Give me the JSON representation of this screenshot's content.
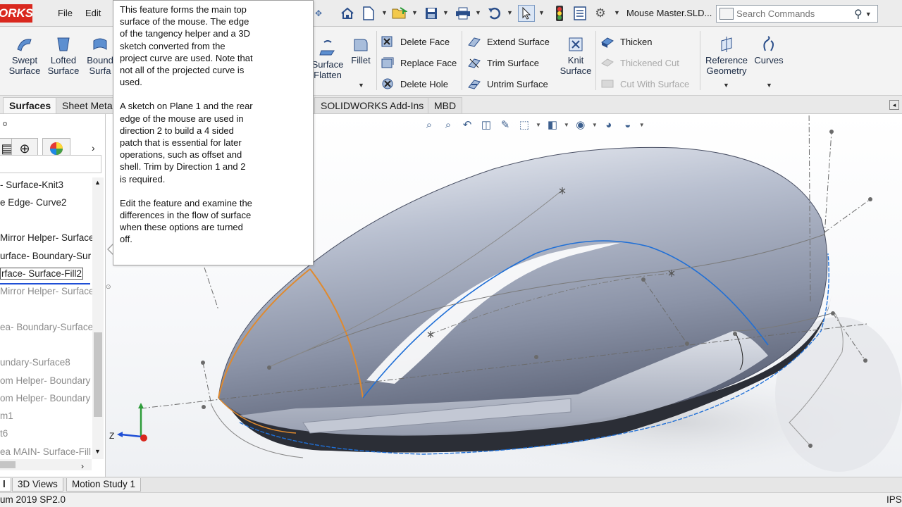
{
  "app": {
    "logo_text": "ORKS",
    "menu": [
      "File",
      "Edit"
    ],
    "document_title": "Mouse Master.SLD...",
    "search": {
      "placeholder": "Search Commands"
    }
  },
  "quick_access_icons": [
    "home-icon",
    "new-document-icon",
    "open-icon",
    "save-icon",
    "print-icon",
    "undo-icon",
    "select-cursor-icon",
    "traffic-light-icon",
    "file-properties-icon",
    "options-gear-icon"
  ],
  "ribbon": {
    "left_buttons": [
      {
        "id": "swept",
        "label": "Swept\nSurface"
      },
      {
        "id": "lofted",
        "label": "Lofted\nSurface"
      },
      {
        "id": "boundary",
        "label": "Bound\nSurfa"
      }
    ],
    "surface_flatten": "Surface\nFlatten",
    "fillet": "Fillet",
    "face_group": [
      "Delete Face",
      "Replace Face",
      "Delete Hole"
    ],
    "surface_group": [
      "Extend Surface",
      "Trim Surface",
      "Untrim Surface"
    ],
    "knit": "Knit\nSurface",
    "thicken_group": [
      {
        "label": "Thicken",
        "enabled": true
      },
      {
        "label": "Thickened Cut",
        "enabled": false
      },
      {
        "label": "Cut With Surface",
        "enabled": false
      }
    ],
    "reference_geometry": "Reference\nGeometry",
    "curves": "Curves"
  },
  "command_tabs": [
    "Surfaces",
    "Sheet Metal",
    "SOLIDWORKS Add-Ins",
    "MBD"
  ],
  "active_command_tab": "Surfaces",
  "tooltip": {
    "paragraphs": [
      "This feature forms the main top\n surface of the mouse. The edge\n of the tangency helper and a 3D\n sketch converted from the\n project curve are used. Note that\n not all of the projected curve is\n used.",
      "A sketch on Plane 1 and the rear\n edge of the mouse are used in\n direction 2 to build a 4 sided\n patch that is essential for later\n operations, such as offset and\n shell. Trim by Direction 1 and 2\n is required.",
      "Edit the feature and examine the\n differences in the flow of surface\n when these options are turned\n off."
    ]
  },
  "feature_tree": {
    "items": [
      {
        "text": "- Surface-Knit3",
        "dim": false
      },
      {
        "text": "e Edge- Curve2",
        "dim": false
      },
      {
        "text": "Mirror Helper- Surface",
        "dim": false
      },
      {
        "text": "urface- Boundary-Sur",
        "dim": false
      },
      {
        "text": "rface- Surface-Fill2",
        "dim": false,
        "selected": true
      },
      {
        "text": "Mirror Helper- Surface",
        "dim": true
      },
      {
        "text": "ea- Boundary-Surface",
        "dim": true
      },
      {
        "text": "undary-Surface8",
        "dim": true
      },
      {
        "text": "om Helper- Boundary",
        "dim": true
      },
      {
        "text": "om Helper- Boundary",
        "dim": true
      },
      {
        "text": "m1",
        "dim": true
      },
      {
        "text": "t6",
        "dim": true
      },
      {
        "text": "ea MAIN- Surface-Fill",
        "dim": true
      }
    ]
  },
  "bottom_tabs": [
    "l",
    "3D Views",
    "Motion Study 1"
  ],
  "status": {
    "left": "um 2019 SP2.0",
    "right": "IPS"
  },
  "triad": {
    "z_label": "Z"
  },
  "colors": {
    "accent": "#d9281e",
    "selection_blue": "#1f6fd6",
    "edge_orange": "#e08a2e"
  }
}
